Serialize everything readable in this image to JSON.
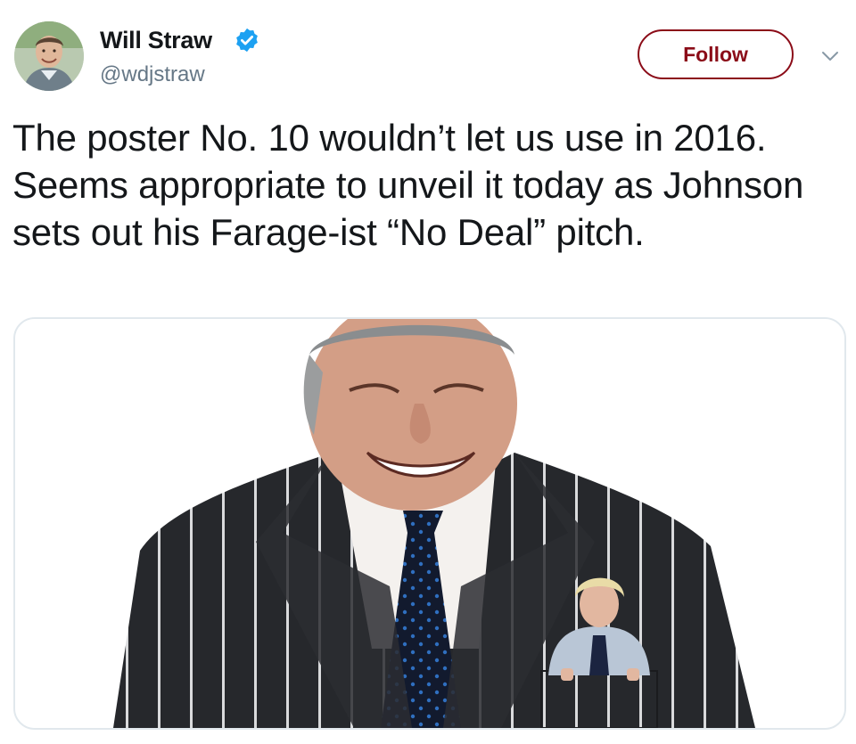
{
  "author": {
    "name": "Will Straw",
    "handle": "@wdjstraw",
    "verified": true,
    "avatar_icon": "profile-photo"
  },
  "actions": {
    "follow_label": "Follow",
    "menu_icon": "chevron-down-icon"
  },
  "tweet": {
    "text": "The poster No. 10 wouldn’t let us use in 2016. Seems appropriate to unveil it today as Johnson sets out his Farage-ist “No Deal” pitch."
  },
  "media": {
    "kind": "photo",
    "description_icon": "poster-image"
  },
  "colors": {
    "follow_accent": "#8b0c18",
    "verified_blue": "#1da1f2",
    "handle_gray": "#657786",
    "border_gray": "#e1e8ed",
    "text": "#14171a"
  }
}
